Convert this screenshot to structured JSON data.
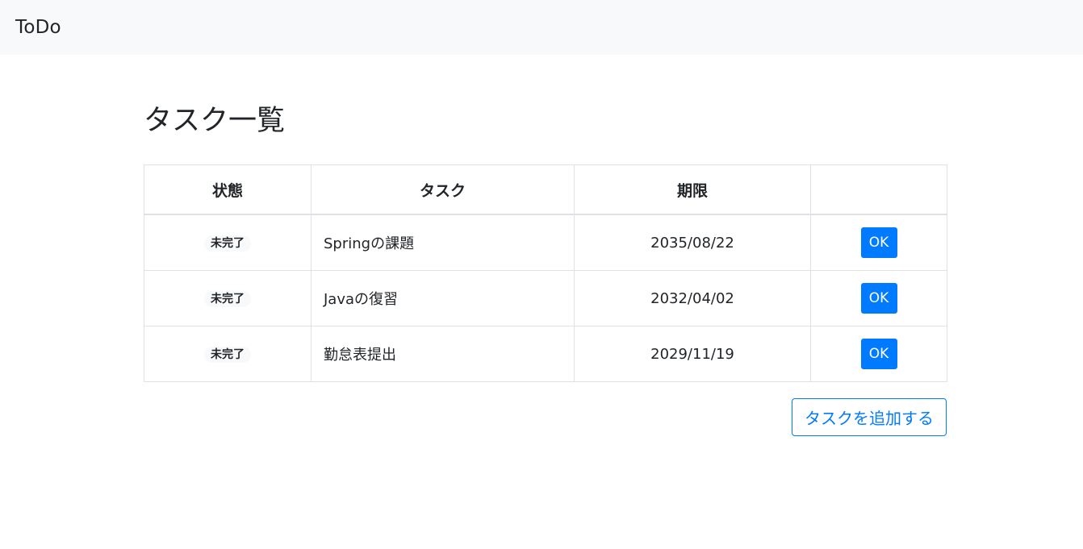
{
  "navbar": {
    "brand": "ToDo"
  },
  "page": {
    "title": "タスク一覧"
  },
  "table": {
    "headers": {
      "status": "状態",
      "task": "タスク",
      "due": "期限",
      "action": ""
    },
    "rows": [
      {
        "status": "未完了",
        "task": "Springの課題",
        "due": "2035/08/22",
        "action": "OK"
      },
      {
        "status": "未完了",
        "task": "Javaの復習",
        "due": "2032/04/02",
        "action": "OK"
      },
      {
        "status": "未完了",
        "task": "勤怠表提出",
        "due": "2029/11/19",
        "action": "OK"
      }
    ]
  },
  "add_button": {
    "label": "タスクを追加する"
  },
  "colors": {
    "primary": "#007bff",
    "navbar_bg": "#f8f9fa",
    "border": "#dee2e6",
    "text": "#212529"
  }
}
